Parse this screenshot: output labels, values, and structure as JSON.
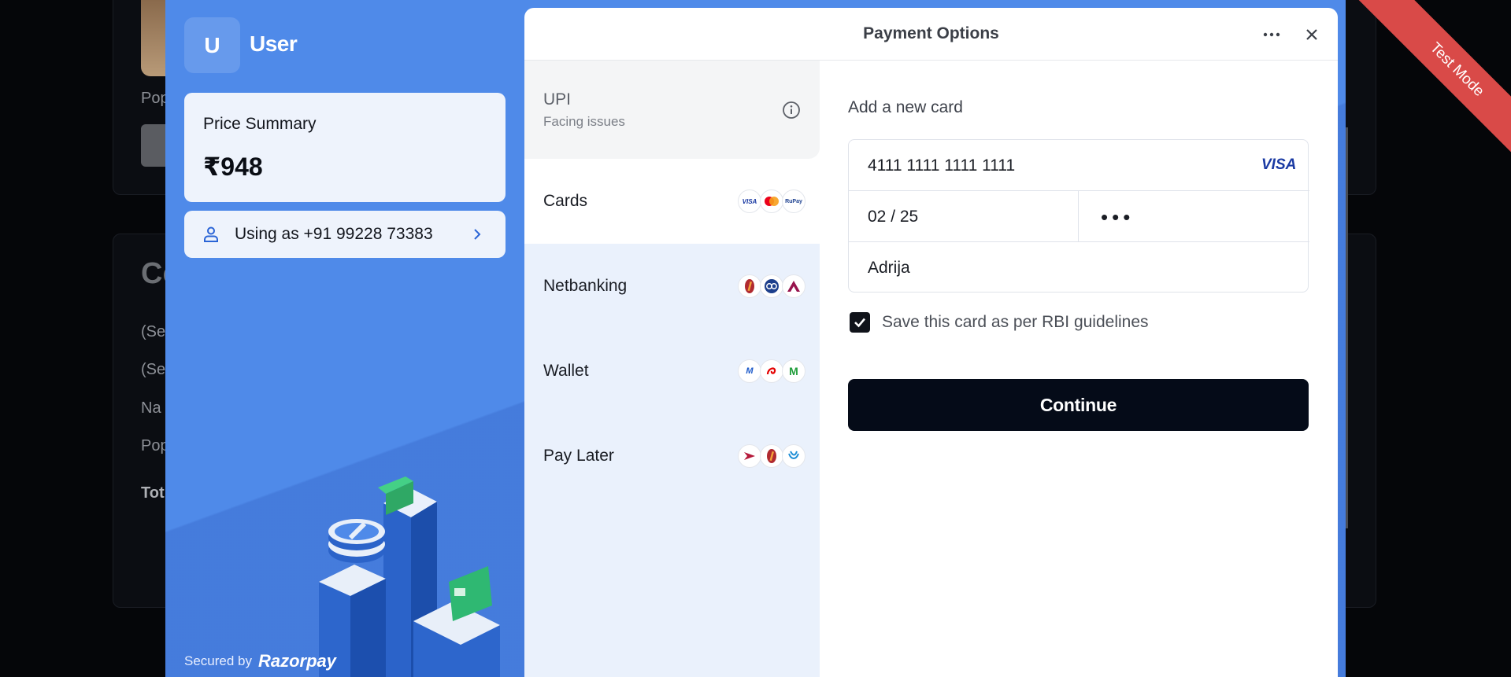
{
  "background": {
    "text_fragments": [
      "Pop",
      "Co",
      "(Se",
      "(Se",
      "Na",
      "Pop",
      "Tot"
    ]
  },
  "merchant": {
    "avatar_letter": "U",
    "name": "User"
  },
  "price_summary": {
    "label": "Price Summary",
    "amount": "₹948"
  },
  "user": {
    "label": "Using as +91 99228 73383"
  },
  "footer": {
    "secured_by": "Secured by",
    "brand": "Razorpay"
  },
  "header": {
    "title": "Payment Options"
  },
  "methods": {
    "upi": {
      "label": "UPI",
      "status": "Facing issues"
    },
    "cards": {
      "label": "Cards",
      "badges": [
        "VISA",
        "Mastercard",
        "RuPay"
      ]
    },
    "netbanking": {
      "label": "Netbanking",
      "badges": [
        "ICICI",
        "HDFC",
        "Axis"
      ]
    },
    "wallet": {
      "label": "Wallet",
      "badges": [
        "Mobikwik",
        "Airtel",
        "Jio"
      ]
    },
    "paylater": {
      "label": "Pay Later",
      "badges": [
        "ePayLater",
        "ICICI",
        "Simpl"
      ]
    }
  },
  "card_form": {
    "title": "Add a new card",
    "card_number": "4111 1111 1111 1111",
    "network": "VISA",
    "expiry": "02 / 25",
    "cvv_masked": "•••",
    "name": "Adrija",
    "save_label": "Save this card as per RBI guidelines",
    "save_checked": true,
    "continue_label": "Continue"
  },
  "ribbon": {
    "label": "Test Mode"
  },
  "colors": {
    "modal_bg": "#4f8ae9",
    "accent_dark": "#050b18",
    "ribbon": "#d94a48",
    "visa": "#1a3aa3"
  }
}
